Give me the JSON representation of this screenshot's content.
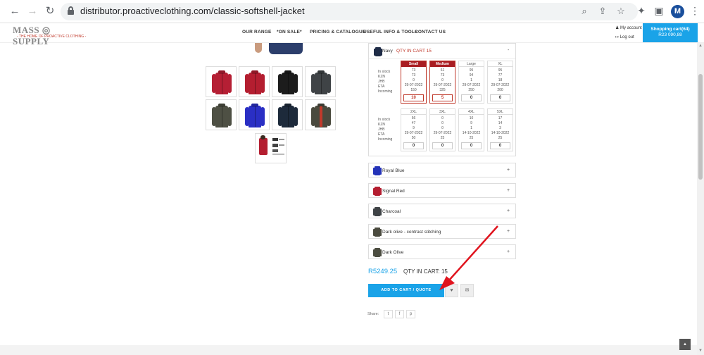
{
  "browser": {
    "url": "distributor.proactiveclothing.com/classic-softshell-jacket",
    "profile_initial": "M"
  },
  "site": {
    "logo_text": "MASS ◎ SUPPLY",
    "logo_tagline": "- THE HOME OF PROACTIVE CLOTHING -",
    "nav": [
      "OUR RANGE",
      "*ON SALE*",
      "PRICING & CATALOGUE",
      "USEFUL INFO & TOOLS",
      "CONTACT US"
    ],
    "my_account": "My account",
    "log_out": "Log out",
    "cart_label": "Shopping cart(64)",
    "cart_total": "R23 090,88"
  },
  "thumb_colors": [
    {
      "name": "red-1",
      "color": "#b51f34"
    },
    {
      "name": "red-2",
      "color": "#b41e30"
    },
    {
      "name": "black",
      "color": "#1c1c1c"
    },
    {
      "name": "charcoal",
      "color": "#3f4346"
    },
    {
      "name": "olive",
      "color": "#4e5044"
    },
    {
      "name": "royal-blue",
      "color": "#2a2fc4"
    },
    {
      "name": "navy",
      "color": "#1d2a3b"
    },
    {
      "name": "dark-olive-contrast",
      "color": "#4a4a3e"
    }
  ],
  "product": {
    "expanded_variant": {
      "label": "Navy",
      "cart_text": "QTY IN CART 15",
      "toggle": "-",
      "color": "#1f2c47",
      "row_labels": [
        "In stock",
        "KZN",
        "JHB",
        "ETA",
        "Incoming"
      ],
      "sizes_row1": [
        {
          "size": "Small",
          "values": [
            "73",
            "73",
            "0",
            "29-07-2022",
            "150"
          ],
          "qty": "10",
          "selected": true
        },
        {
          "size": "Medium",
          "values": [
            "61",
            "73",
            "0",
            "29-07-2022",
            "325"
          ],
          "qty": "5",
          "selected": true
        },
        {
          "size": "Large",
          "values": [
            "95",
            "94",
            "1",
            "29-07-2022",
            "250"
          ],
          "qty": "0",
          "selected": false
        },
        {
          "size": "XL",
          "values": [
            "95",
            "77",
            "18",
            "29-07-2022",
            "200"
          ],
          "qty": "0",
          "selected": false
        }
      ],
      "sizes_row2": [
        {
          "size": "2XL",
          "values": [
            "56",
            "47",
            "9",
            "29-07-2022",
            "50"
          ],
          "qty": "0",
          "selected": false
        },
        {
          "size": "3XL",
          "values": [
            "0",
            "0",
            "0",
            "29-07-2022",
            "25"
          ],
          "qty": "0",
          "selected": false
        },
        {
          "size": "4XL",
          "values": [
            "10",
            "9",
            "1",
            "14-10-2022",
            "25"
          ],
          "qty": "0",
          "selected": false
        },
        {
          "size": "5XL",
          "values": [
            "17",
            "14",
            "3",
            "14-10-2022",
            "25"
          ],
          "qty": "0",
          "selected": false
        }
      ]
    },
    "other_variants": [
      {
        "label": "Royal Blue",
        "toggle": "+",
        "color": "#2433b8"
      },
      {
        "label": "Signal Red",
        "toggle": "+",
        "color": "#b41e30"
      },
      {
        "label": "Charcoal",
        "toggle": "+",
        "color": "#3e4245"
      },
      {
        "label": "Dark olive - contrast stitching",
        "toggle": "+",
        "color": "#4a4a3e"
      },
      {
        "label": "Dark Olive",
        "toggle": "+",
        "color": "#4b4c40"
      }
    ],
    "price": "R5249.25",
    "qty_in_cart": "QTY IN CART:   15",
    "add_button": "ADD TO CART / QUOTE",
    "share_label": "Share:"
  },
  "colors": {
    "accent": "#1aa3e8",
    "selected_red": "#a91d22",
    "arrow": "#e0141e"
  }
}
